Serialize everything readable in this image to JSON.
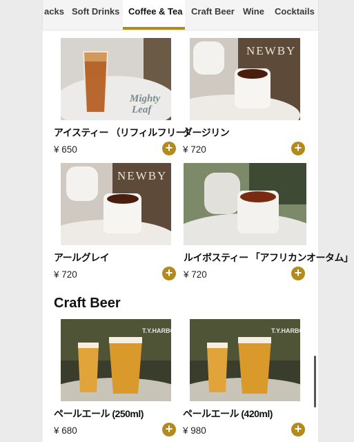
{
  "tabs": [
    {
      "label": "acks",
      "active": false
    },
    {
      "label": "Soft Drinks",
      "active": false
    },
    {
      "label": "Coffee & Tea",
      "active": true
    },
    {
      "label": "Craft Beer",
      "active": false
    },
    {
      "label": "Wine",
      "active": false
    },
    {
      "label": "Cocktails",
      "active": false
    }
  ],
  "items": [
    {
      "title": "アイスティー （リフィルフリー）",
      "price": "¥ 650",
      "logo": "Mighty Leaf"
    },
    {
      "title": "ダージリン",
      "price": "¥ 720",
      "logo": "NEWBY"
    },
    {
      "title": "アールグレイ",
      "price": "¥ 720",
      "logo": "NEWBY"
    },
    {
      "title": "ルイボスティー 「アフリカンオータム」",
      "price": "¥ 720",
      "logo": ""
    },
    {
      "title": "ペールエール (250ml)",
      "price": "¥ 680",
      "logo": "T.Y.HARBOR"
    },
    {
      "title": "ペールエール (420ml)",
      "price": "¥ 980",
      "logo": "T.Y.HARBOR"
    }
  ],
  "sections": {
    "craft_beer": "Craft Beer"
  },
  "add_symbol": "+",
  "accent_color": "#b38a1d"
}
